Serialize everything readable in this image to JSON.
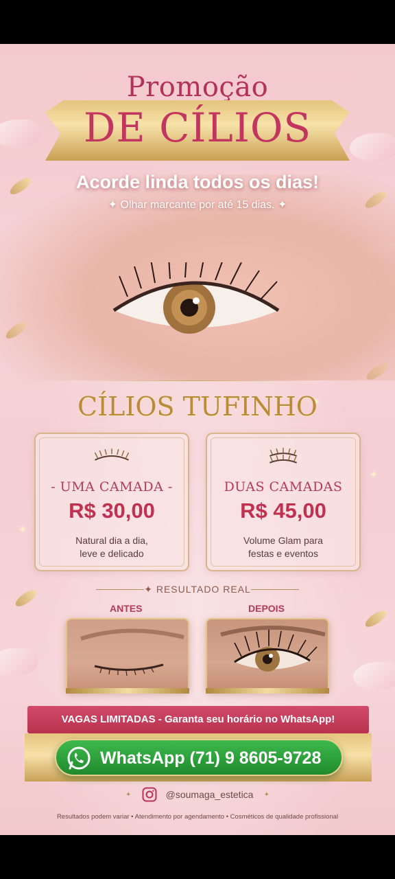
{
  "header": {
    "promo": "Promoção",
    "title": "DE CÍLIOS",
    "tagline": "Acorde linda todos os dias!",
    "subtagline": "Olhar marcante por até 15 dias."
  },
  "section": {
    "title": "CÍLIOS TUFINHO"
  },
  "cards": [
    {
      "name": "- UMA CAMADA -",
      "price": "R$ 30,00",
      "desc_line1": "Natural dia a dia,",
      "desc_line2": "leve e delicado"
    },
    {
      "name": "DUAS CAMADAS",
      "price": "R$ 45,00",
      "desc_line1": "Volume Glam para",
      "desc_line2": "festas e eventos"
    }
  ],
  "results": {
    "label": "RESULTADO REAL",
    "before": "ANTES",
    "after": "DEPOIS"
  },
  "cta": {
    "vagas": "VAGAS LIMITADAS - Garanta seu horário no WhatsApp!",
    "whatsapp": "WhatsApp (71) 9 8605-9728"
  },
  "social": {
    "instagram": "@soumaga_estetica"
  },
  "footer": {
    "text": "Resultados podem variar  •  Atendimento por agendamento  •  Cosméticos de qualidade profissional"
  },
  "colors": {
    "accent_pink": "#c2355f",
    "gold": "#b98c3a",
    "whatsapp_green": "#2aa53a"
  }
}
